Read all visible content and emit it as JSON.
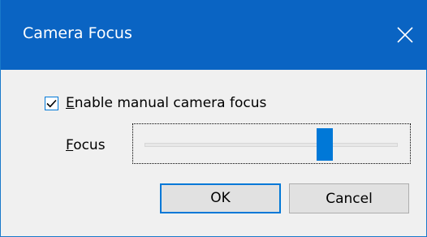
{
  "window": {
    "title": "Camera Focus"
  },
  "checkbox": {
    "label_first": "E",
    "label_rest": "nable manual camera focus",
    "checked": true
  },
  "focus": {
    "label_first": "F",
    "label_rest": "ocus",
    "slider_value_percent": 71
  },
  "buttons": {
    "ok_label": "OK",
    "cancel_label": "Cancel"
  },
  "icons": {
    "close": "close-icon",
    "check": "checkmark-icon"
  },
  "colors": {
    "titlebar": "#0a64c3",
    "accent": "#0078d7"
  }
}
